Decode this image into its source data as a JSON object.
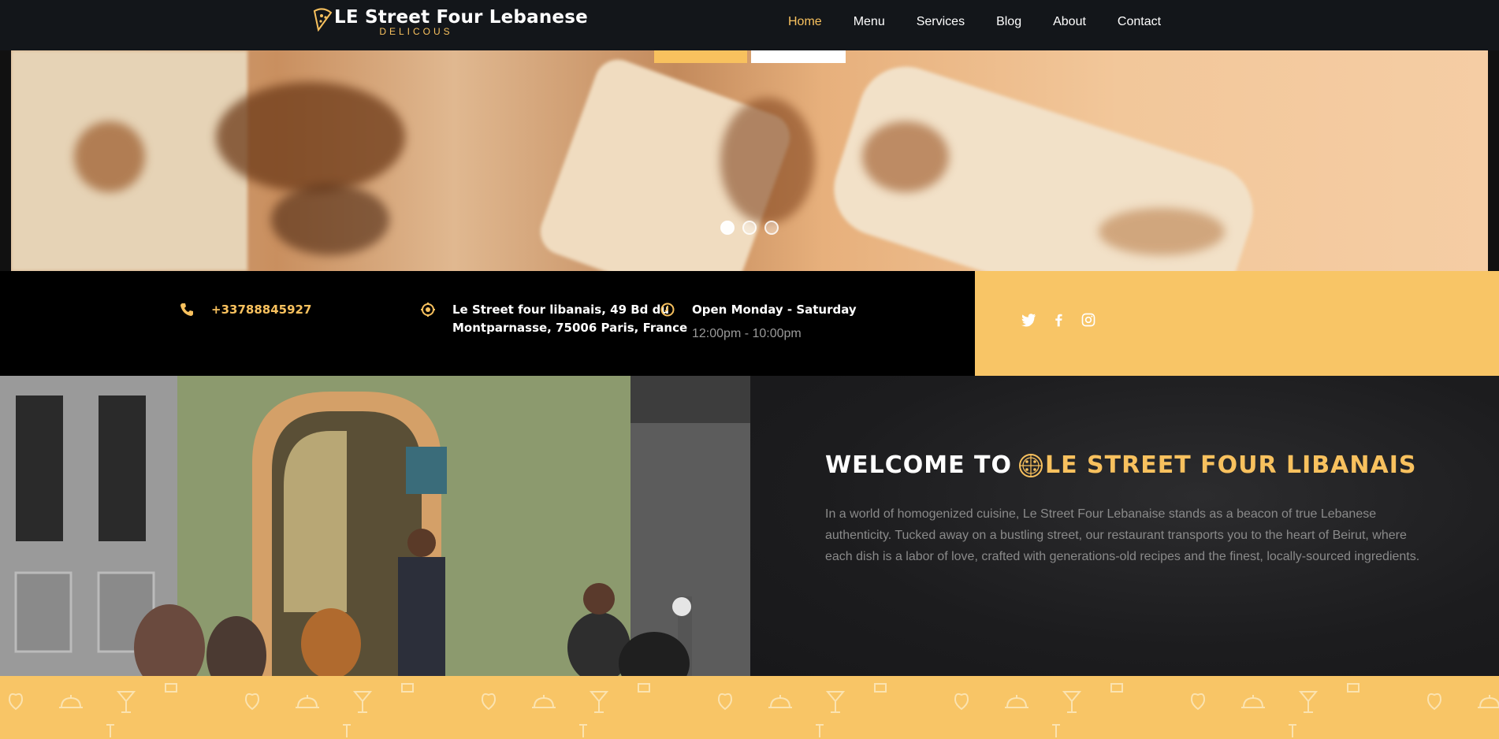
{
  "brand": {
    "title": "LE Street Four Lebanese",
    "subtitle": "DELICOUS"
  },
  "nav": {
    "items": [
      "Home",
      "Menu",
      "Services",
      "Blog",
      "About",
      "Contact"
    ],
    "active": "Home"
  },
  "hero": {
    "slides": 3,
    "active_slide": 1
  },
  "info": {
    "phone": "+33788845927",
    "address_line1": "Le Street four libanais, 49 Bd du",
    "address_line2": "Montparnasse, 75006 Paris, France",
    "open_days": "Open Monday - Saturday",
    "open_hours": "12:00pm - 10:00pm"
  },
  "social": [
    "twitter-icon",
    "facebook-icon",
    "instagram-icon"
  ],
  "welcome": {
    "title_prefix": "WELCOME TO",
    "title_highlight": "LE STREET FOUR LIBANAIS",
    "body": "In a world of homogenized cuisine, Le Street Four Lebanaise stands as a beacon of true Lebanese authenticity. Tucked away on a bustling street, our restaurant transports you to the heart of Beirut, where each dish is a labor of love, crafted with generations-old recipes and the finest, locally-sourced ingredients."
  },
  "colors": {
    "accent": "#f8c15e",
    "nav_bg": "#13161a",
    "info_bg": "#000000",
    "social_bg": "#f8c566",
    "welcome_bg": "#1c1c1e"
  }
}
